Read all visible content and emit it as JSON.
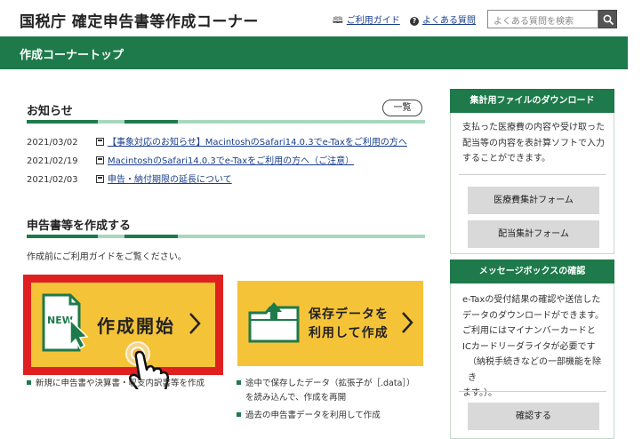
{
  "header": {
    "site_title": "国税庁 確定申告書等作成コーナー",
    "guide_link": "ご利用ガイド",
    "faq_link": "よくある質問",
    "search_placeholder": "よくある質問を検索"
  },
  "navbar": {
    "title": "作成コーナートップ"
  },
  "notices": {
    "title": "お知らせ",
    "list_button": "一覧",
    "items": [
      {
        "date": "2021/03/02",
        "text": "【事象対応のお知らせ】MacintoshのSafari14.0.3でe-Taxをご利用の方へ"
      },
      {
        "date": "2021/02/19",
        "text": "MacintoshのSafari14.0.3でe-Taxをご利用の方へ（ご注意）"
      },
      {
        "date": "2021/02/03",
        "text": "申告・納付期限の延長について"
      }
    ]
  },
  "create": {
    "title": "申告書等を作成する",
    "note": "作成前にご利用ガイドをご覧ください。",
    "start_button": {
      "label": "作成開始",
      "badge": "NEW"
    },
    "saved_button": {
      "line1": "保存データを",
      "line2": "利用して作成"
    },
    "start_bullets": [
      "新規に申告書や決算書・収支内訳書等を作成"
    ],
    "saved_bullets": [
      "途中で保存したデータ（拡張子が［.data］）",
      "を読み込んで、作成を再開",
      "過去の申告書データを利用して作成"
    ]
  },
  "sidebar": {
    "download": {
      "title": "集計用ファイルのダウンロード",
      "text": [
        "支払った医療費の内容や受け取った",
        "配当等の内容を表計算ソフトで入力",
        "することができます。"
      ],
      "buttons": [
        "医療費集計フォーム",
        "配当集計フォーム"
      ]
    },
    "messagebox": {
      "title": "メッセージボックスの確認",
      "text": [
        "e-Taxの受付結果の確認や送信した",
        "データのダウンロードができます。",
        "ご利用にはマイナンバーカードと",
        "ICカードリーダライタが必要です",
        "（納税手続きなどの一部機能を除き",
        "ます。）。"
      ],
      "button": "確認する"
    }
  },
  "colors": {
    "brand_green": "#1e7a4a",
    "button_yellow": "#f5c338",
    "highlight_red": "#e02020",
    "link_blue": "#1a3e8c"
  }
}
